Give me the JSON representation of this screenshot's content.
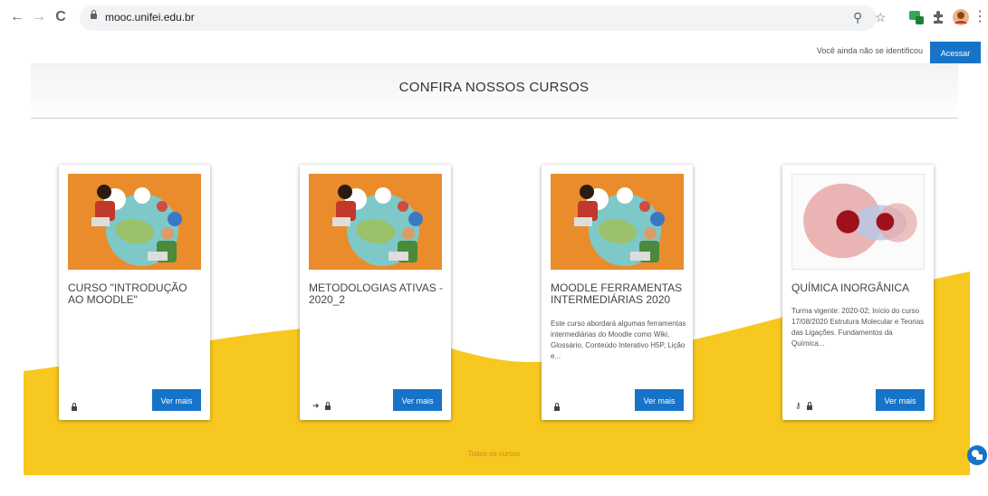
{
  "browser": {
    "url": "mooc.unifei.edu.br",
    "back_symbol": "←",
    "forward_symbol": "→",
    "reload_symbol": "C",
    "zoom_symbol": "⚲",
    "star_symbol": "☆",
    "menu_symbol": "⋮"
  },
  "login": {
    "status_text": "Você ainda não se identificou",
    "button_label": "Acessar"
  },
  "section": {
    "title": "CONFIRA NOSSOS CURSOS"
  },
  "courses": [
    {
      "title": "CURSO \"INTRODUÇÃO AO MOODLE\"",
      "summary": "",
      "image": "people-network-illustration",
      "icons": [
        "lock-icon"
      ],
      "button": "Ver mais"
    },
    {
      "title": "METODOLOGIAS ATIVAS - 2020_2",
      "summary": "",
      "image": "people-network-illustration",
      "icons": [
        "sign-in-icon",
        "lock-icon"
      ],
      "button": "Ver mais"
    },
    {
      "title": "MOODLE FERRAMENTAS INTERMEDIÁRIAS 2020",
      "summary": "Este curso abordará algumas ferramentas intermediárias do Moodle como Wiki, Glossário, Conteúdo Interativo H5P, Lição e...",
      "image": "people-network-illustration",
      "icons": [
        "lock-icon"
      ],
      "button": "Ver mais"
    },
    {
      "title": "QUÍMICA INORGÂNICA",
      "summary": "Turma vigente: 2020-02; Início do curso 17/08/2020 Estrutura Molecular e Teorias das Ligações. Fundamentos da Química...",
      "image": "molecular-orbital-illustration",
      "icons": [
        "key-icon",
        "lock-icon"
      ],
      "button": "Ver mais"
    }
  ],
  "footer": {
    "all_courses": "Todos os cursos"
  },
  "colors": {
    "accent": "#1773c7",
    "wave": "#f7c81f",
    "thumb_orange": "#ea8c2c"
  }
}
